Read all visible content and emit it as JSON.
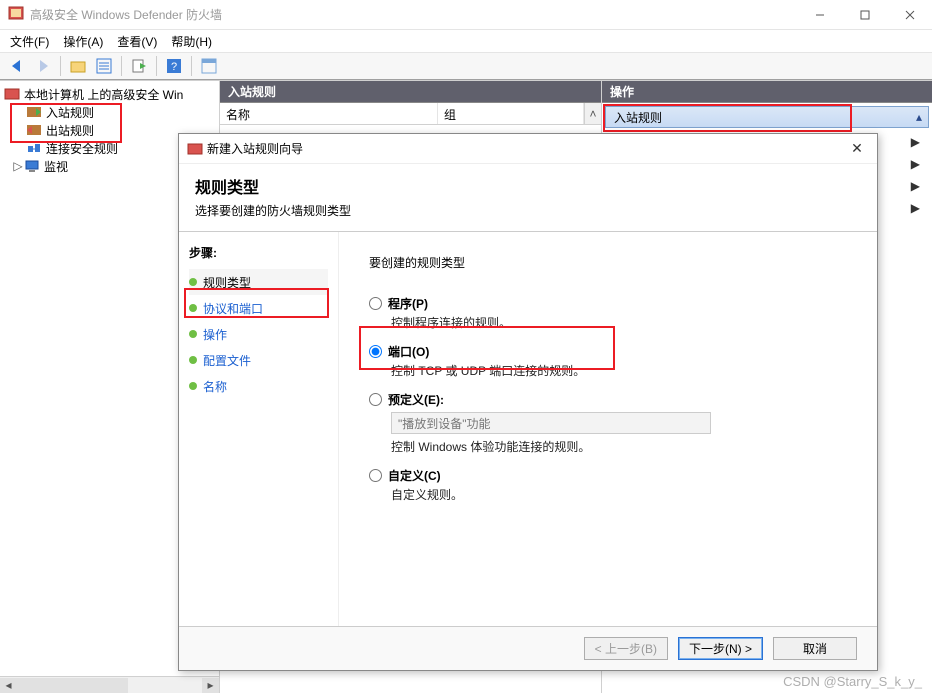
{
  "window": {
    "title": "高级安全 Windows Defender 防火墙"
  },
  "menus": {
    "file": "文件(F)",
    "action": "操作(A)",
    "view": "查看(V)",
    "help": "帮助(H)"
  },
  "tree": {
    "root": "本地计算机 上的高级安全 Win",
    "inbound": "入站规则",
    "outbound": "出站规则",
    "connsec": "连接安全规则",
    "monitor": "监视"
  },
  "mid": {
    "header": "入站规则",
    "col_name": "名称",
    "col_group": "组"
  },
  "right": {
    "header": "操作",
    "section": "入站规则"
  },
  "wizard": {
    "title": "新建入站规则向导",
    "heading": "规则类型",
    "subheading": "选择要创建的防火墙规则类型",
    "steps_label": "步骤:",
    "steps": {
      "rule_type": "规则类型",
      "proto_port": "协议和端口",
      "operation": "操作",
      "profile": "配置文件",
      "name": "名称"
    },
    "question": "要创建的规则类型",
    "opts": {
      "program_label": "程序(P)",
      "program_desc": "控制程序连接的规则。",
      "port_label": "端口(O)",
      "port_desc": "控制 TCP 或 UDP 端口连接的规则。",
      "predef_label": "预定义(E):",
      "predef_value": "\"播放到设备\"功能",
      "predef_desc": "控制 Windows 体验功能连接的规则。",
      "custom_label": "自定义(C)",
      "custom_desc": "自定义规则。"
    },
    "buttons": {
      "back": "< 上一步(B)",
      "next": "下一步(N) >",
      "cancel": "取消"
    }
  },
  "watermark": "CSDN @Starry_S_k_y_"
}
